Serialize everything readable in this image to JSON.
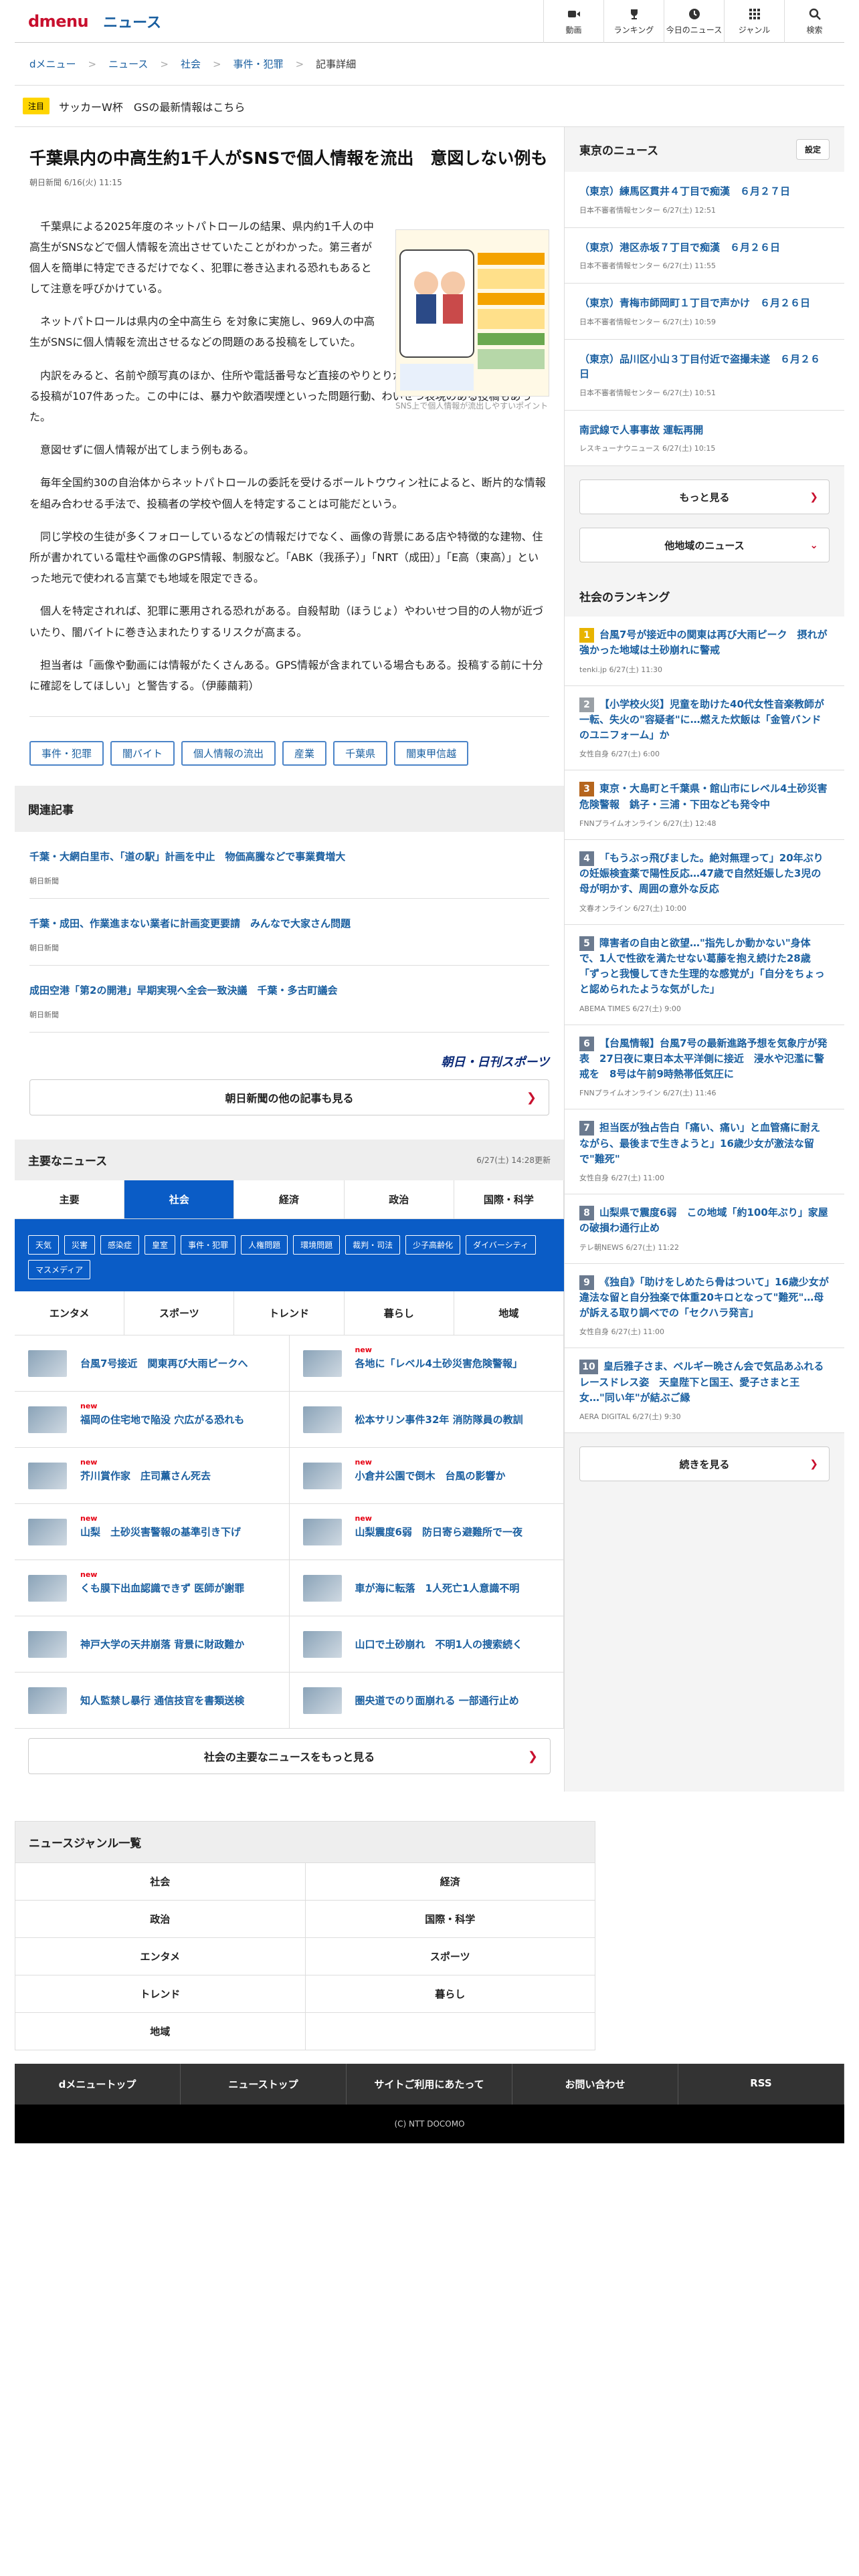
{
  "header": {
    "logo": "dmenu",
    "section": "ニュース",
    "nav": [
      {
        "label": "動画",
        "icon": "video-icon"
      },
      {
        "label": "ランキング",
        "icon": "trophy-icon"
      },
      {
        "label": "今日のニュース",
        "icon": "clock-icon"
      },
      {
        "label": "ジャンル",
        "icon": "grid-icon"
      },
      {
        "label": "検索",
        "icon": "search-icon"
      }
    ]
  },
  "breadcrumb": [
    "dメニュー",
    "ニュース",
    "社会",
    "事件・犯罪",
    "記事詳細"
  ],
  "notice": {
    "tag": "注目",
    "text": "サッカーW杯　GSの最新情報はこちら"
  },
  "article": {
    "title": "千葉県内の中高生約1千人がSNSで個人情報を流出　意図しない例も",
    "date": "朝日新聞 6/16(火) 11:15",
    "figure_caption": "SNS上で個人情報が流出しやすいポイント",
    "figure_title": "SNS上で個人情報が流出しやすいポイント",
    "paragraphs": [
      "千葉県による2025年度のネットパトロールの結果、県内約1千人の中高生がSNSなどで個人情報を流出させていたことがわかった。第三者が個人を簡単に特定できるだけでなく、犯罪に巻き込まれる恐れもあるとして注意を呼びかけている。",
      "ネットパトロールは県内の全中高生ら を対象に実施し、969人の中高生がSNSに個人情報を流出させるなどの問題のある投稿をしていた。",
      "内訳をみると、名前や顔写真のほか、住所や電話番号など直接のやりとりが容易となる個人情報が含まれる投稿が107件あった。この中には、暴力や飲酒喫煙といった問題行動、わいせつ表現のある投稿もあった。",
      "意図せずに個人情報が出てしまう例もある。",
      "毎年全国約30の自治体からネットパトロールの委託を受けるボールトウウィン社によると、断片的な情報を組み合わせる手法で、投稿者の学校や個人を特定することは可能だという。",
      "同じ学校の生徒が多くフォローしているなどの情報だけでなく、画像の背景にある店や特徴的な建物、住所が書かれている電柱や画像のGPS情報、制服など。「ABK（我孫子）」「NRT（成田）」「E高（東高）」といった地元で使われる言葉でも地域を限定できる。",
      "個人を特定されれば、犯罪に悪用される恐れがある。自殺幇助（ほうじょ）やわいせつ目的の人物が近づいたり、闇バイトに巻き込まれたりするリスクが高まる。",
      "担当者は「画像や動画には情報がたくさんある。GPS情報が含まれている場合もある。投稿する前に十分に確認をしてほしい」と警告する。（伊藤繭莉）"
    ],
    "tags": [
      "事件・犯罪",
      "闇バイト",
      "個人情報の流出",
      "産業",
      "千葉県",
      "闇東甲信越"
    ]
  },
  "related": {
    "heading": "関連記事",
    "items": [
      {
        "title": "千葉・大網白里市、「道の駅」計画を中止　物価高騰などで事業費増大",
        "source": "朝日新聞"
      },
      {
        "title": "千葉・成田、作業進まない業者に計画変更要請　みんなで大家さん問題",
        "source": "朝日新聞"
      },
      {
        "title": "成田空港「第2の開港」早期実現へ全会一致決議　千葉・多古町議会",
        "source": "朝日新聞"
      }
    ],
    "brand": "朝日・日刊スポーツ",
    "more": "朝日新聞の他の記事も見る"
  },
  "major": {
    "heading": "主要なニュース",
    "updated": "6/27(土) 14:28更新",
    "tabs": [
      "主要",
      "社会",
      "経済",
      "政治",
      "国際・科学"
    ],
    "subtags": [
      "天気",
      "災害",
      "感染症",
      "皇室",
      "事件・犯罪",
      "人権問題",
      "環境問題",
      "裁判・司法",
      "少子高齢化",
      "ダイバーシティ",
      "マスメディア"
    ],
    "tabs2": [
      "エンタメ",
      "スポーツ",
      "トレンド",
      "暮らし",
      "地域"
    ],
    "news": [
      {
        "title": "台風7号接近　関東再び大雨ピークへ",
        "new": ""
      },
      {
        "title": "各地に「レベル4土砂災害危険警報」",
        "new": "new"
      },
      {
        "title": "福岡の住宅地で陥没 穴広がる恐れも",
        "new": "new"
      },
      {
        "title": "松本サリン事件32年 消防隊員の教訓",
        "new": ""
      },
      {
        "title": "芥川賞作家　庄司薫さん死去",
        "new": "new"
      },
      {
        "title": "小倉井公園で倒木　台風の影響か",
        "new": "new"
      },
      {
        "title": "山梨　土砂災害警報の基準引き下げ",
        "new": "new"
      },
      {
        "title": "山梨震度6弱　防日寄ら避難所で一夜",
        "new": "new"
      },
      {
        "title": "くも膜下出血認識できず 医師が謝罪",
        "new": "new"
      },
      {
        "title": "車が海に転落　1人死亡1人意識不明",
        "new": ""
      },
      {
        "title": "神戸大学の天井崩落 背景に財政難か",
        "new": ""
      },
      {
        "title": "山口で土砂崩れ　不明1人の捜索続く",
        "new": ""
      },
      {
        "title": "知人監禁し暴行 通信技官を書類送検",
        "new": ""
      },
      {
        "title": "圏央道でのり面崩れる 一部通行止め",
        "new": ""
      }
    ],
    "more": "社会の主要なニュースをもっと見る"
  },
  "tokyo": {
    "heading": "東京のニュース",
    "setting": "設定",
    "items": [
      {
        "title": "（東京）練馬区貫井４丁目で痴漢　６月２７日",
        "source": "日本不審者情報センター 6/27(土) 12:51"
      },
      {
        "title": "（東京）港区赤坂７丁目で痴漢　６月２６日",
        "source": "日本不審者情報センター 6/27(土) 11:55"
      },
      {
        "title": "（東京）青梅市師岡町１丁目で声かけ　６月２６日",
        "source": "日本不審者情報センター 6/27(土) 10:59"
      },
      {
        "title": "（東京）品川区小山３丁目付近で盗撮未遂　６月２６日",
        "source": "日本不審者情報センター 6/27(土) 10:51"
      },
      {
        "title": "南武線で人事事故 運転再開",
        "source": "レスキューナウニュース 6/27(土) 10:15"
      }
    ],
    "more": "もっと見る",
    "other": "他地域のニュース"
  },
  "ranking": {
    "heading": "社会のランキング",
    "items": [
      {
        "num": "1",
        "color": "#e8b400",
        "title": "台風7号が接近中の関東は再び大雨ピーク　摂れが強かった地域は土砂崩れに警戒",
        "source": "tenki.jp 6/27(土) 11:30"
      },
      {
        "num": "2",
        "color": "#9aa0a6",
        "title": "【小学校火災】児童を助けた40代女性音楽教師が一転、失火の\"容疑者\"に…燃えた炊飯は「金管バンドのユニフォーム」か",
        "source": "女性自身 6/27(土) 6:00"
      },
      {
        "num": "3",
        "color": "#b5651d",
        "title": "東京・大島町と千葉県・館山市にレベル4土砂災害危険警報　銚子・三浦・下田なども発令中",
        "source": "FNNプライムオンライン 6/27(土) 12:48"
      },
      {
        "num": "4",
        "color": "#6b7a8f",
        "title": "「もうぶっ飛びました。絶対無理って」20年ぶりの妊娠検査薬で陽性反応…47歳で自然妊娠した3児の母が明かす、周囲の意外な反応",
        "source": "文春オンライン 6/27(土) 10:00"
      },
      {
        "num": "5",
        "color": "#6b7a8f",
        "title": "障害者の自由と欲望…\"指先しか動かない\"身体で、1人で性欲を満たせない葛藤を抱え続けた28歳「ずっと我慢してきた生理的な感覚が」「自分をちょっと認められたような気がした」",
        "source": "ABEMA TIMES 6/27(土) 9:00"
      },
      {
        "num": "6",
        "color": "#6b7a8f",
        "title": "【台風情報】台風7号の最新進路予想を気象庁が発表　27日夜に東日本太平洋側に接近　浸水や氾濫に警戒を　8号は午前9時熱帯低気圧に",
        "source": "FNNプライムオンライン 6/27(土) 11:46"
      },
      {
        "num": "7",
        "color": "#6b7a8f",
        "title": "担当医が独占告白「痛い、痛い」と血管痛に耐えながら、最後まで生きようと」16歳少女が激法な留で\"難死\"",
        "source": "女性自身 6/27(土) 11:00"
      },
      {
        "num": "8",
        "color": "#6b7a8f",
        "title": "山梨県で震度6弱　この地域「約100年ぶり」家屋の破損わ通行止め",
        "source": "テレ朝NEWS 6/27(土) 11:22"
      },
      {
        "num": "9",
        "color": "#6b7a8f",
        "title": "《独自》「助けをしめたら骨はついて」16歳少女が違法な留と自分独楽で体重20キロとなって\"難死\"…母が訴える取り調べでの「セクハラ発言」",
        "source": "女性自身 6/27(土) 11:00"
      },
      {
        "num": "10",
        "color": "#6b7a8f",
        "title": "皇后雅子さま、ベルギー晩さん会で気品あふれるレースドレス姿　天皇陛下と国王、愛子さまと王女…\"同い年\"が結ぶご縁",
        "source": "AERA DIGITAL 6/27(土) 9:30"
      }
    ],
    "more": "続きを見る"
  },
  "genre": {
    "heading": "ニュースジャンル一覧",
    "items": [
      "社会",
      "経済",
      "政治",
      "国際・科学",
      "エンタメ",
      "スポーツ",
      "トレンド",
      "暮らし",
      "地域",
      ""
    ]
  },
  "footer": {
    "links": [
      "dメニュートップ",
      "ニューストップ",
      "サイトご利用にあたって",
      "お問い合わせ",
      "RSS"
    ],
    "copyright": "(C) NTT DOCOMO"
  }
}
